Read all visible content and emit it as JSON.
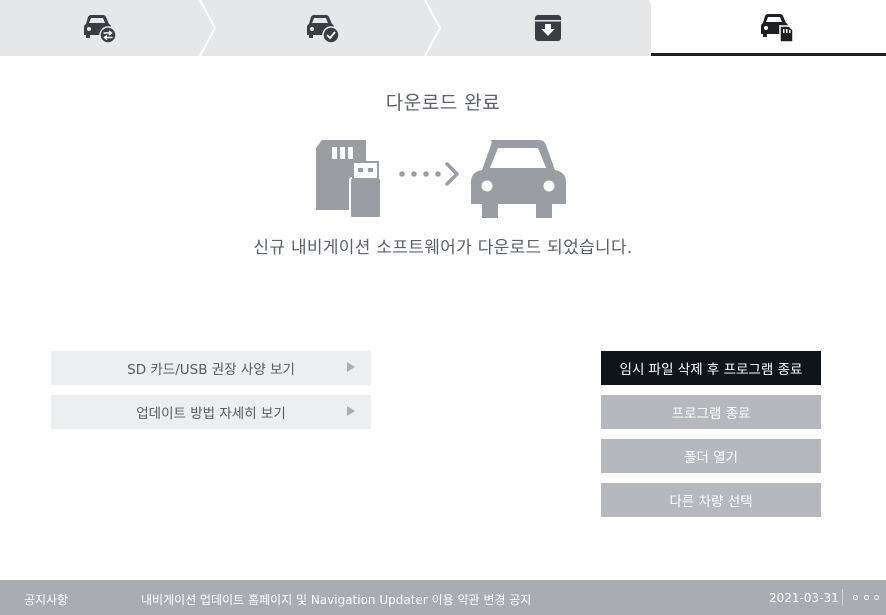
{
  "stepper": {
    "steps": [
      {
        "icon": "car-sync-icon",
        "state": "done"
      },
      {
        "icon": "car-check-icon",
        "state": "done"
      },
      {
        "icon": "download-box-icon",
        "state": "done"
      },
      {
        "icon": "car-sdcard-icon",
        "state": "active"
      }
    ]
  },
  "main": {
    "title": "다운로드 완료",
    "illustration": {
      "icons": [
        "sd-card-icon",
        "usb-drive-icon",
        "dotted-arrow-icon",
        "car-icon"
      ]
    },
    "message": "신규 내비게이션 소프트웨어가 다운로드 되었습니다."
  },
  "links": {
    "sd_usb_specs": "SD 카드/USB 권장 사양 보기",
    "update_guide": "업데이트 방법 자세히 보기"
  },
  "actions": {
    "delete_and_exit": "임시 파일 삭제 후 프로그램 종료",
    "exit": "프로그램 종료",
    "open_folder": "폴더 열기",
    "select_other_vehicle": "다른 차량 선택"
  },
  "footer": {
    "label": "공지사항",
    "notice": "내비게이션 업데이트 홈페이지 및 Navigation Updater 이용 약관 변경 공지",
    "date": "2021-03-31"
  },
  "colors": {
    "primary_button": "#0f1419",
    "secondary_button": "#b5b8bc",
    "footer_bg": "#a9acb0",
    "stepper_bg": "#e6e7e8"
  }
}
